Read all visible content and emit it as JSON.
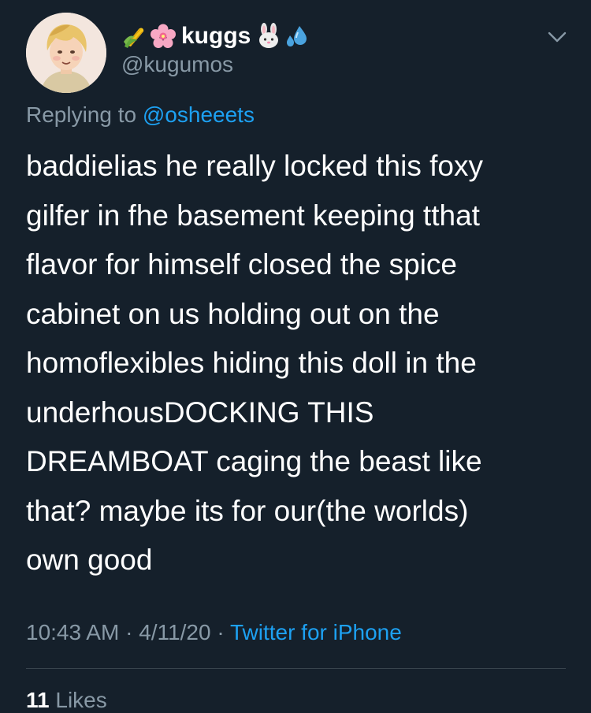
{
  "theme": {
    "background": "#15202b",
    "text_primary": "#ffffff",
    "text_secondary": "#8899a6",
    "link": "#1da1f2",
    "divider": "#38444d"
  },
  "author": {
    "avatar_icon": "avatar-illustration",
    "name_emoji_before": [
      "corn-emoji-icon",
      "cherry-blossom-emoji-icon"
    ],
    "display_name": "kuggs",
    "name_emoji_after": [
      "rabbit-face-emoji-icon",
      "sweat-droplets-emoji-icon"
    ],
    "handle": "@kugumos"
  },
  "menu": {
    "icon": "chevron-down-icon"
  },
  "reply": {
    "prefix": "Replying to",
    "mention": "@osheeets"
  },
  "tweet": {
    "text": "baddielias he really locked this foxy\ngilfer in fhe basement keeping tthat\nflavor for himself closed the spice\ncabinet on us holding out on the\nhomoflexibles hiding this doll in the\nunderhousDOCKING THIS\nDREAMBOAT caging the beast like\nthat? maybe its for our(the worlds)\nown good"
  },
  "meta": {
    "time": "10:43 AM",
    "sep1": " · ",
    "date": "4/11/20",
    "sep2": " · ",
    "source": "Twitter for iPhone"
  },
  "stats": {
    "likes_count": "11",
    "likes_label": "Likes"
  }
}
